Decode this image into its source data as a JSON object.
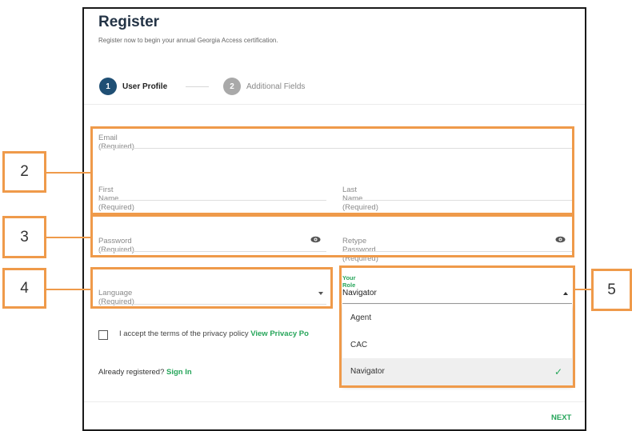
{
  "header": {
    "title": "Register",
    "subtitle": "Register now to begin your annual Georgia Access certification."
  },
  "steps": [
    {
      "number": "1",
      "label": "User Profile"
    },
    {
      "number": "2",
      "label": "Additional Fields"
    }
  ],
  "form": {
    "email_label": "Email (Required)",
    "first_name_label": "First Name (Required)",
    "last_name_label": "Last Name (Required)",
    "password_label": "Password (Required)",
    "retype_password_label": "Retype Password (Required)",
    "language_label": "Language (Required)",
    "role_label": "Your Role",
    "role_value": "Navigator"
  },
  "role_options": [
    {
      "label": "Agent",
      "selected": false
    },
    {
      "label": "CAC",
      "selected": false
    },
    {
      "label": "Navigator",
      "selected": true
    }
  ],
  "terms": {
    "text": "I accept the terms of the privacy policy",
    "link": "View Privacy Po"
  },
  "signin": {
    "text": "Already registered?",
    "link": "Sign In"
  },
  "footer": {
    "next_label": "NEXT"
  },
  "annotations": [
    "2",
    "3",
    "4",
    "5"
  ],
  "colors": {
    "accent_green": "#26a55a",
    "step_active": "#1f4f74",
    "annotation_orange": "#ef9a4a"
  },
  "icons": {
    "password_toggle": "eye-icon",
    "select_arrow": "caret-icon",
    "selected_option": "checkmark-icon"
  }
}
